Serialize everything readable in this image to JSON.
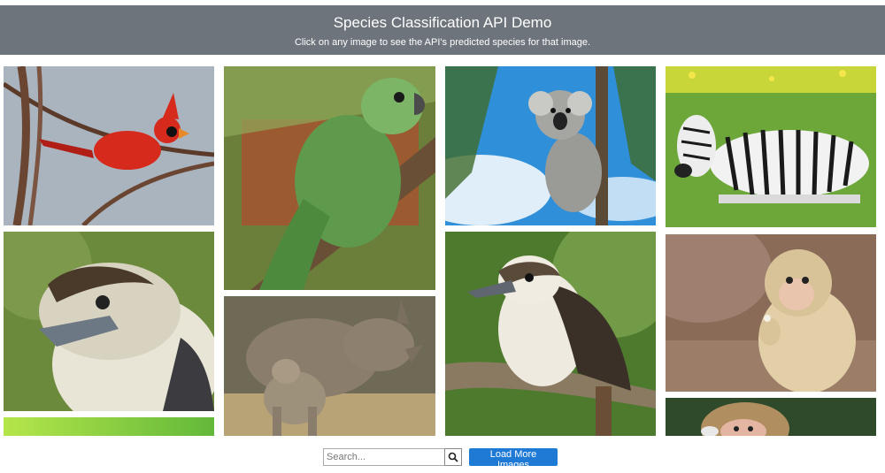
{
  "header": {
    "title": "Species Classification API Demo",
    "subtitle": "Click on any image to see the API's predicted species for that image."
  },
  "gallery": {
    "images": [
      {
        "subject": "northern cardinal"
      },
      {
        "subject": "kookaburra"
      },
      {
        "subject": "green foliage"
      },
      {
        "subject": "green parrot"
      },
      {
        "subject": "rhinoceros with calf"
      },
      {
        "subject": "koala"
      },
      {
        "subject": "kookaburra on branch"
      },
      {
        "subject": "zebra"
      },
      {
        "subject": "baboon infant"
      },
      {
        "subject": "macaque"
      }
    ]
  },
  "controls": {
    "search_placeholder": "Search...",
    "search_icon": "search-icon",
    "load_more_label": "Load More Images"
  },
  "colors": {
    "header_bg": "#6d747c",
    "button_blue": "#1f7ad6"
  }
}
